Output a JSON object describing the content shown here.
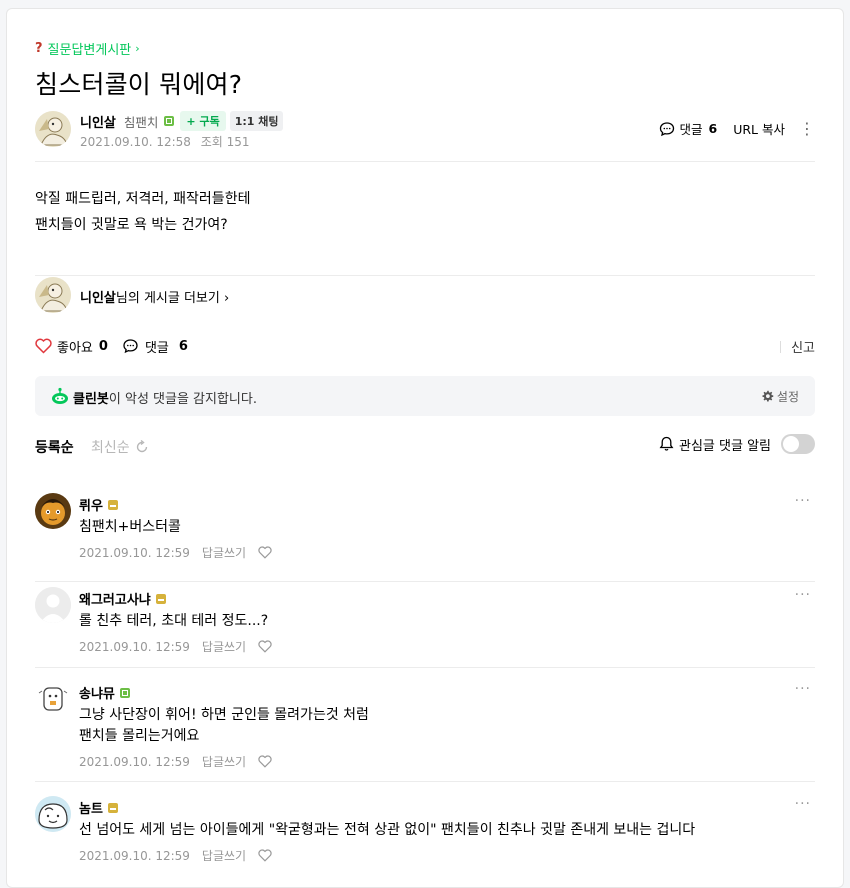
{
  "board": {
    "name": "질문답변게시판",
    "chevron": "›"
  },
  "post": {
    "title": "침스터콜이 뭐에여?",
    "author": {
      "name": "니인살",
      "grade": "침팬치",
      "subscribe_label": "+ 구독",
      "chat_label": "1:1 채팅",
      "date": "2021.09.10. 12:58",
      "views": "조회 151"
    },
    "tools": {
      "comment_label": "댓글",
      "comment_count": "6",
      "url_copy": "URL 복사",
      "more": "⋮"
    },
    "body_lines": [
      "악질 패드립러, 저격러, 패작러들한테",
      "팬치들이 귓말로 욕 박는 건가여?"
    ],
    "more_posts": {
      "author": "니인살",
      "suffix": "님의 게시글 더보기",
      "chevron": "›"
    },
    "reactions": {
      "like_label": "좋아요",
      "like_count": "0",
      "comment_label": "댓글",
      "comment_count": "6",
      "report": "신고"
    }
  },
  "cleanbot": {
    "name": "클린봇",
    "message": "이 악성 댓글을 감지합니다.",
    "settings": "설정"
  },
  "sort": {
    "registered": "등록순",
    "latest": "최신순",
    "notify_label": "관심글 댓글 알림"
  },
  "comments": [
    {
      "name": "뤼우",
      "badge": "v",
      "text": [
        "침팬치+버스터콜"
      ],
      "date": "2021.09.10. 12:59",
      "reply": "답글쓰기"
    },
    {
      "name": "왜그러고사냐",
      "badge": "v",
      "text": [
        "롤 친추 테러, 초대 테러 정도...?"
      ],
      "date": "2021.09.10. 12:59",
      "reply": "답글쓰기"
    },
    {
      "name": "송냐뮤",
      "badge": "g",
      "text": [
        "그냥 사단장이 휘어! 하면 군인들 몰려가는것 처럼",
        "팬치들 몰리는거에요"
      ],
      "date": "2021.09.10. 12:59",
      "reply": "답글쓰기"
    },
    {
      "name": "놈트",
      "badge": "v",
      "text": [
        "선 넘어도 세게 넘는 아이들에게 \"왁굳형과는 전혀 상관 없이\" 팬치들이 친추나 귓말 존내게 보내는 겁니다"
      ],
      "date": "2021.09.10. 12:59",
      "reply": "답글쓰기"
    }
  ],
  "colors": {
    "accent": "#03c75a",
    "like": "#e0383e",
    "badge_gold": "#d6b23b",
    "badge_green": "#6cbe45"
  }
}
